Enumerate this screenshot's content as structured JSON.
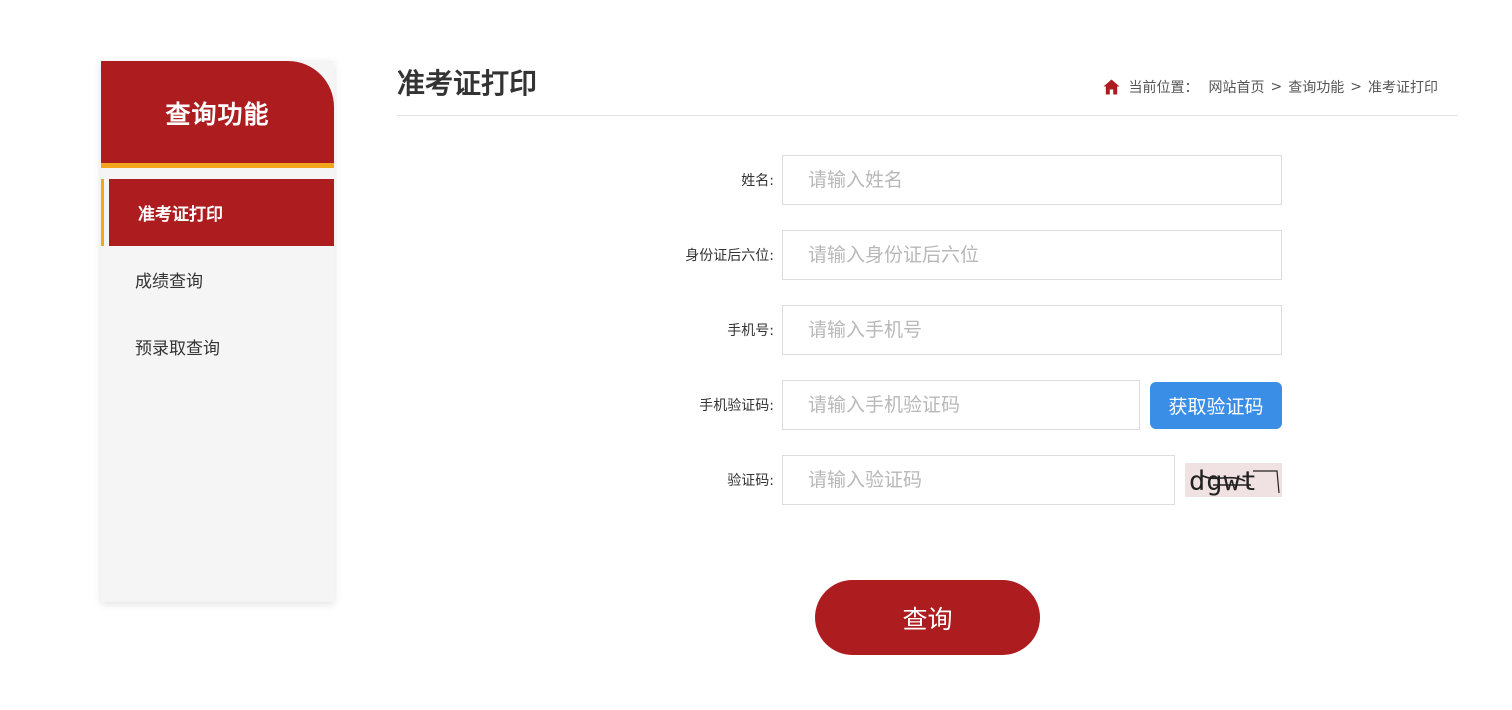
{
  "sidebar": {
    "title": "查询功能",
    "items": [
      {
        "label": "准考证打印",
        "active": true
      },
      {
        "label": "成绩查询",
        "active": false
      },
      {
        "label": "预录取查询",
        "active": false
      }
    ]
  },
  "header": {
    "title": "准考证打印",
    "breadcrumb": {
      "icon": "home-icon",
      "label": "当前位置：",
      "items": [
        "网站首页",
        "查询功能",
        "准考证打印"
      ],
      "separator": ">"
    }
  },
  "form": {
    "name": {
      "label": "姓名:",
      "placeholder": "请输入姓名",
      "value": ""
    },
    "id_last6": {
      "label": "身份证后六位:",
      "placeholder": "请输入身份证后六位",
      "value": ""
    },
    "phone": {
      "label": "手机号:",
      "placeholder": "请输入手机号",
      "value": ""
    },
    "sms_code": {
      "label": "手机验证码:",
      "placeholder": "请输入手机验证码",
      "value": "",
      "button_label": "获取验证码"
    },
    "captcha": {
      "label": "验证码:",
      "placeholder": "请输入验证码",
      "value": "",
      "image_text": "dgwt"
    },
    "submit_label": "查询"
  },
  "colors": {
    "brand_red": "#ad1c1f",
    "accent_orange": "#f2a51f",
    "button_blue": "#3a8ee6"
  }
}
